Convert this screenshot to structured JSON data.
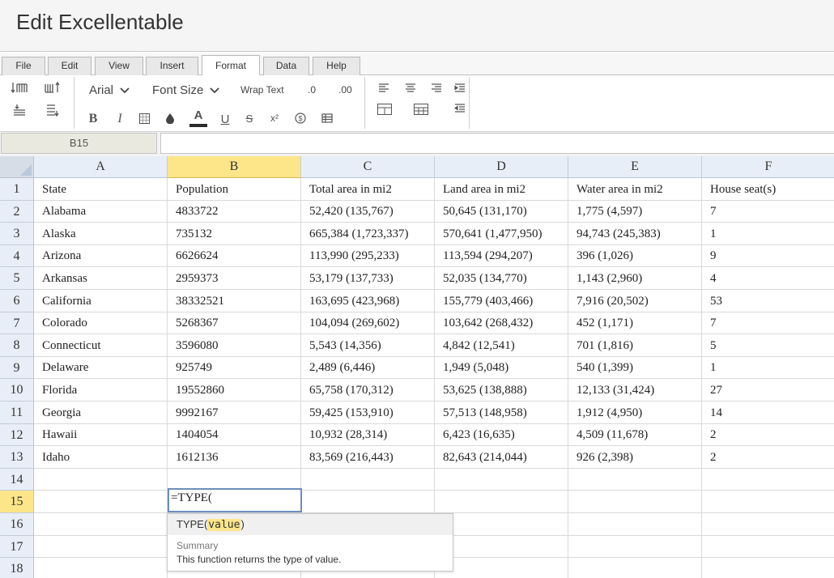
{
  "title": "Edit Excellentable",
  "tabs": [
    "File",
    "Edit",
    "View",
    "Insert",
    "Format",
    "Data",
    "Help"
  ],
  "active_tab": "Format",
  "toolbar": {
    "font_name": "Arial",
    "font_size_label": "Font Size",
    "wrap_text_label": "Wrap Text",
    "decrease_decimal_label": ".0",
    "increase_decimal_label": ".00",
    "bold_label": "B",
    "italic_label": "I",
    "underline_label": "U",
    "strike_label": "S",
    "superscript_label": "x²",
    "currency_label": "$",
    "font_color_label": "A",
    "accent_color": "#2c2c2c"
  },
  "cell_ref": "B15",
  "formula_value": "",
  "columns": [
    "A",
    "B",
    "C",
    "D",
    "E",
    "F"
  ],
  "selected_column": "B",
  "selected_row": "15",
  "row_numbers": [
    "1",
    "2",
    "3",
    "4",
    "5",
    "6",
    "7",
    "8",
    "9",
    "10",
    "11",
    "12",
    "13",
    "14",
    "15",
    "16",
    "17",
    "18"
  ],
  "rows": [
    [
      "State",
      "Population",
      "Total area in mi2",
      "Land area in mi2",
      "Water area in mi2",
      "House seat(s)"
    ],
    [
      "Alabama",
      "4833722",
      "52,420 (135,767)",
      "50,645 (131,170)",
      "1,775 (4,597)",
      "7"
    ],
    [
      "Alaska",
      "735132",
      "665,384 (1,723,337)",
      "570,641 (1,477,950)",
      "94,743 (245,383)",
      "1"
    ],
    [
      "Arizona",
      "6626624",
      "113,990 (295,233)",
      "113,594 (294,207)",
      "396 (1,026)",
      "9"
    ],
    [
      "Arkansas",
      "2959373",
      "53,179 (137,733)",
      "52,035 (134,770)",
      "1,143 (2,960)",
      "4"
    ],
    [
      "California",
      "38332521",
      "163,695 (423,968)",
      "155,779 (403,466)",
      "7,916 (20,502)",
      "53"
    ],
    [
      "Colorado",
      "5268367",
      "104,094 (269,602)",
      "103,642 (268,432)",
      "452 (1,171)",
      "7"
    ],
    [
      "Connecticut",
      "3596080",
      "5,543 (14,356)",
      "4,842 (12,541)",
      "701 (1,816)",
      "5"
    ],
    [
      "Delaware",
      "925749",
      "2,489 (6,446)",
      "1,949 (5,048)",
      "540 (1,399)",
      "1"
    ],
    [
      "Florida",
      "19552860",
      "65,758 (170,312)",
      "53,625 (138,888)",
      "12,133 (31,424)",
      "27"
    ],
    [
      "Georgia",
      "9992167",
      "59,425 (153,910)",
      "57,513 (148,958)",
      "1,912 (4,950)",
      "14"
    ],
    [
      "Hawaii",
      "1404054",
      "10,932 (28,314)",
      "6,423 (16,635)",
      "4,509 (11,678)",
      "2"
    ],
    [
      "Idaho",
      "1612136",
      "83,569 (216,443)",
      "82,643 (214,044)",
      "926 (2,398)",
      "2"
    ],
    [
      "",
      "",
      "",
      "",
      "",
      ""
    ],
    [
      "",
      "",
      "",
      "",
      "",
      ""
    ],
    [
      "",
      "",
      "",
      "",
      "",
      ""
    ],
    [
      "",
      "",
      "",
      "",
      "",
      ""
    ],
    [
      "",
      "",
      "",
      "",
      "",
      ""
    ]
  ],
  "editor_value": "=TYPE(",
  "autocomplete": {
    "fn_name": "TYPE(",
    "arg": "value",
    "close": ")",
    "summary_label": "Summary",
    "description": "This function returns the type of value."
  }
}
